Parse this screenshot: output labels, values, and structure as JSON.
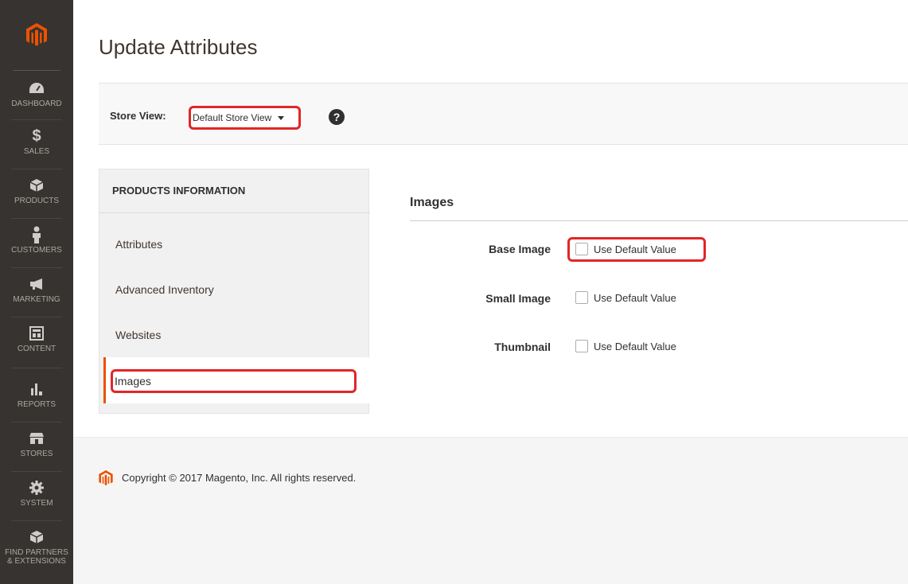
{
  "sidebar": {
    "items": [
      {
        "label": "DASHBOARD",
        "icon": "dashboard-icon"
      },
      {
        "label": "SALES",
        "icon": "dollar-icon"
      },
      {
        "label": "PRODUCTS",
        "icon": "box-icon"
      },
      {
        "label": "CUSTOMERS",
        "icon": "person-icon"
      },
      {
        "label": "MARKETING",
        "icon": "megaphone-icon"
      },
      {
        "label": "CONTENT",
        "icon": "layout-icon"
      },
      {
        "label": "REPORTS",
        "icon": "bar-chart-icon"
      },
      {
        "label": "STORES",
        "icon": "storefront-icon"
      },
      {
        "label": "SYSTEM",
        "icon": "gear-icon"
      },
      {
        "label": "FIND PARTNERS",
        "label2": "& EXTENSIONS",
        "icon": "partners-box-icon"
      }
    ]
  },
  "page": {
    "title": "Update Attributes"
  },
  "store_switcher": {
    "label": "Store View:",
    "value": "Default Store View",
    "help": "?"
  },
  "tabs": {
    "header": "PRODUCTS INFORMATION",
    "items": [
      "Attributes",
      "Advanced Inventory",
      "Websites",
      "Images"
    ],
    "active": "Images"
  },
  "images_section": {
    "title": "Images",
    "fields": [
      {
        "label": "Base Image",
        "checkbox_label": "Use Default Value",
        "checked": false
      },
      {
        "label": "Small Image",
        "checkbox_label": "Use Default Value",
        "checked": false
      },
      {
        "label": "Thumbnail",
        "checkbox_label": "Use Default Value",
        "checked": false
      }
    ]
  },
  "footer": {
    "copyright": "Copyright © 2017 Magento, Inc. All rights reserved."
  },
  "colors": {
    "sidebar_bg": "#373330",
    "brand_orange": "#eb5202",
    "highlight_red": "#e22626"
  }
}
